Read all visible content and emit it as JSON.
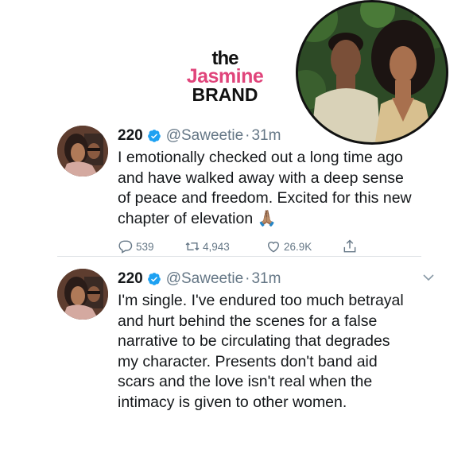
{
  "logo": {
    "line1": "the",
    "line2": "Jasmine",
    "line3": "BRAND"
  },
  "tweets": [
    {
      "name": "220",
      "handle": "@Saweetie",
      "separator": "·",
      "time": "31m",
      "text": "I emotionally checked out a long time ago\nand have walked away with a deep sense\nof peace and freedom. Excited for this new\nchapter of elevation 🙏🏽",
      "replies": "539",
      "retweets": "4,943",
      "likes": "26.9K"
    },
    {
      "name": "220",
      "handle": "@Saweetie",
      "separator": "·",
      "time": "31m",
      "text": "I'm single. I've endured too much betrayal\nand hurt behind the scenes for a false\nnarrative to be circulating that degrades\nmy character. Presents don't band aid\nscars and the love isn't real when the\nintimacy is given to other women."
    }
  ],
  "colors": {
    "verified": "#1da1f2",
    "muted": "#657786",
    "text": "#14171a",
    "brand_pink": "#e0457b"
  }
}
